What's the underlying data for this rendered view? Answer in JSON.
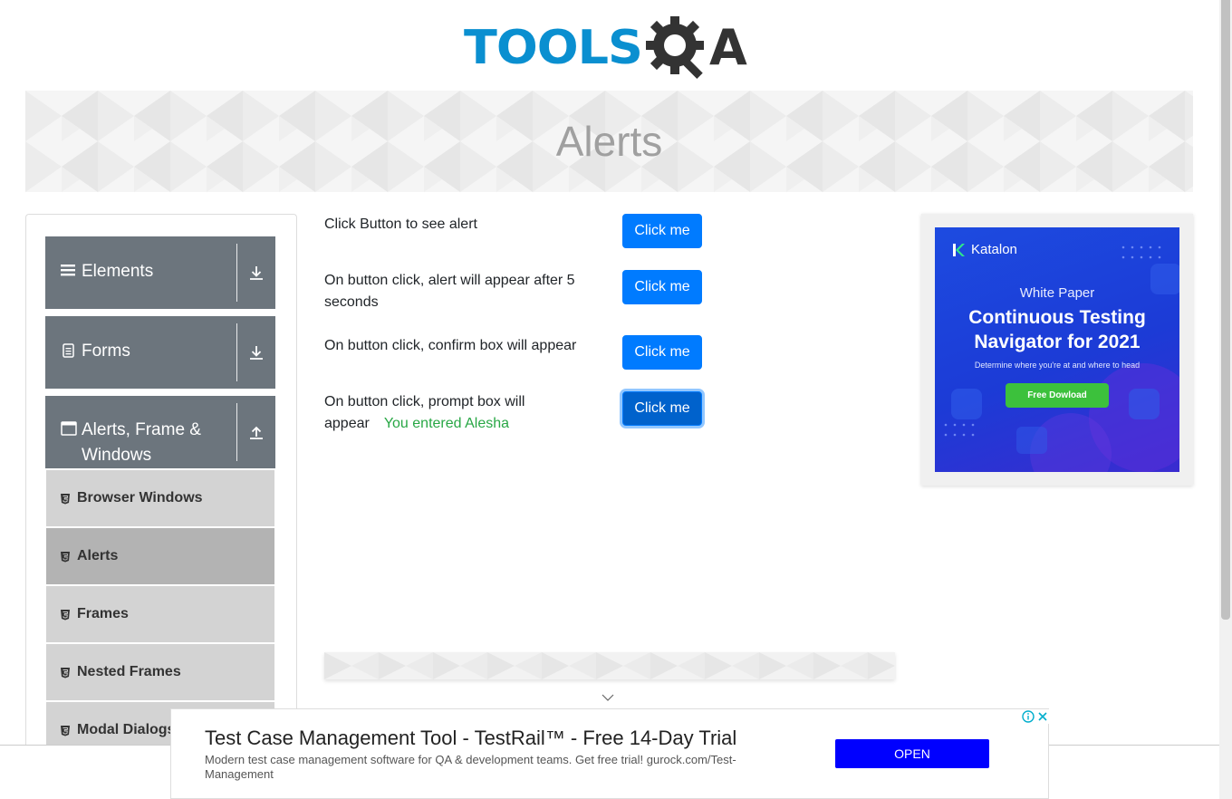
{
  "header": {
    "logo_text_left": "TOOLS",
    "logo_text_right": "A"
  },
  "banner": {
    "title": "Alerts"
  },
  "leftnav": {
    "groups": [
      {
        "label": "Elements",
        "icon": "hamburger-icon",
        "state": "collapsed"
      },
      {
        "label": "Forms",
        "icon": "document-icon",
        "state": "collapsed"
      },
      {
        "label": "Alerts, Frame & Windows",
        "icon": "window-icon",
        "state": "expanded"
      }
    ],
    "items": [
      {
        "label": "Browser Windows",
        "active": false
      },
      {
        "label": "Alerts",
        "active": true
      },
      {
        "label": "Frames",
        "active": false
      },
      {
        "label": "Nested Frames",
        "active": false
      },
      {
        "label": "Modal Dialogs",
        "active": false
      }
    ]
  },
  "alerts": {
    "rows": [
      {
        "label": "Click Button to see alert",
        "button": "Click me"
      },
      {
        "label": "On button click, alert will appear after 5 seconds",
        "button": "Click me"
      },
      {
        "label": "On button click, confirm box will appear",
        "button": "Click me"
      },
      {
        "label": "On button click, prompt box will appear",
        "button": "Click me"
      }
    ],
    "prompt_result": "You entered Alesha"
  },
  "side_ad": {
    "brand": "Katalon",
    "eyebrow": "White Paper",
    "headline_line1": "Continuous Testing",
    "headline_line2": "Navigator for 2021",
    "subtitle": "Determine where you're at and where to head",
    "cta": "Free Dowload"
  },
  "bottom_ad": {
    "title": "Test Case Management Tool - TestRail™ - Free 14-Day Trial",
    "description": "Modern test case management software for QA & development teams. Get free trial! gurock.com/Test-Management",
    "cta": "OPEN"
  },
  "colors": {
    "primary": "#007bff",
    "success": "#28a745",
    "nav_header": "#6c757d",
    "logo_blue": "#0a8fd0"
  }
}
